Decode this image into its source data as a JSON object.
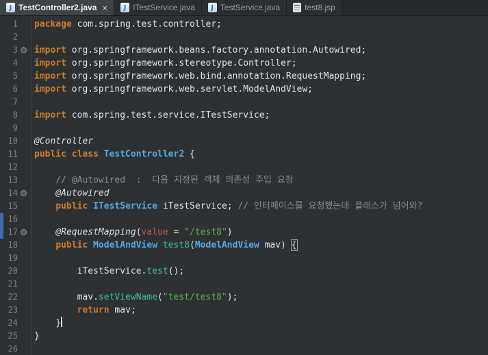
{
  "colors": {
    "editor_background": "#2E3134",
    "tab_bar_background": "#26292B",
    "active_tab_background": "#3E4346",
    "keyword": "#CE7B2C",
    "type": "#55A8E0",
    "string": "#55B345",
    "comment": "#858C91",
    "annotation": "#D9DEE1",
    "annotation_value": "#D14F4F",
    "method": "#3FBD9A",
    "plain_text": "#DFE2E4",
    "line_number": "#7C8287",
    "change_indicator": "#3E6CA8"
  },
  "tab_bar": {
    "tabs": [
      {
        "id": "testcontroller2",
        "label": "TestController2.java",
        "icon": "java-file-icon",
        "active": true,
        "close_label": "×"
      },
      {
        "id": "itestservice",
        "label": "ITestService.java",
        "icon": "java-file-icon",
        "active": false
      },
      {
        "id": "testservice",
        "label": "TestService.java",
        "icon": "java-file-icon",
        "active": false
      },
      {
        "id": "test8jsp",
        "label": "test8.jsp",
        "icon": "jsp-file-icon",
        "active": false
      }
    ]
  },
  "editor": {
    "lines": [
      {
        "num": "1",
        "segs": [
          {
            "c": "k",
            "t": "package"
          },
          {
            "c": "p",
            "t": " com.spring.test.controller;"
          }
        ]
      },
      {
        "num": "2",
        "segs": []
      },
      {
        "num": "3",
        "marker": true,
        "segs": [
          {
            "c": "k",
            "t": "import"
          },
          {
            "c": "p",
            "t": " org.springframework.beans.factory.annotation.Autowired;"
          }
        ]
      },
      {
        "num": "4",
        "segs": [
          {
            "c": "k",
            "t": "import"
          },
          {
            "c": "p",
            "t": " org.springframework.stereotype.Controller;"
          }
        ]
      },
      {
        "num": "5",
        "segs": [
          {
            "c": "k",
            "t": "import"
          },
          {
            "c": "p",
            "t": " org.springframework.web.bind.annotation.RequestMapping;"
          }
        ]
      },
      {
        "num": "6",
        "segs": [
          {
            "c": "k",
            "t": "import"
          },
          {
            "c": "p",
            "t": " org.springframework.web.servlet.ModelAndView;"
          }
        ]
      },
      {
        "num": "7",
        "segs": []
      },
      {
        "num": "8",
        "segs": [
          {
            "c": "k",
            "t": "import"
          },
          {
            "c": "p",
            "t": " com.spring.test.service.ITestService;"
          }
        ]
      },
      {
        "num": "9",
        "segs": []
      },
      {
        "num": "10",
        "segs": [
          {
            "c": "a",
            "t": "@Controller"
          }
        ]
      },
      {
        "num": "11",
        "segs": [
          {
            "c": "k",
            "t": "public class "
          },
          {
            "c": "t",
            "t": "TestController2"
          },
          {
            "c": "p",
            "t": " {"
          }
        ]
      },
      {
        "num": "12",
        "segs": []
      },
      {
        "num": "13",
        "segs": [
          {
            "c": "p",
            "t": "    "
          },
          {
            "c": "c",
            "t": "// @Autowired  :  다음 지정된 객체 의존성 주입 요청"
          }
        ]
      },
      {
        "num": "14",
        "marker": true,
        "segs": [
          {
            "c": "p",
            "t": "    "
          },
          {
            "c": "a",
            "t": "@Autowired"
          }
        ]
      },
      {
        "num": "15",
        "segs": [
          {
            "c": "p",
            "t": "    "
          },
          {
            "c": "k",
            "t": "public "
          },
          {
            "c": "t",
            "t": "ITestService"
          },
          {
            "c": "p",
            "t": " iTestService; "
          },
          {
            "c": "c",
            "t": "// 인터페이스를 요청했는데 클래스가 넘어와?"
          }
        ]
      },
      {
        "num": "16",
        "bar": true,
        "segs": []
      },
      {
        "num": "17",
        "bar": true,
        "marker": true,
        "segs": [
          {
            "c": "p",
            "t": "    "
          },
          {
            "c": "a",
            "t": "@RequestMapping"
          },
          {
            "c": "p",
            "t": "("
          },
          {
            "c": "v",
            "t": "value"
          },
          {
            "c": "p",
            "t": " = "
          },
          {
            "c": "s",
            "t": "\"/test8\""
          },
          {
            "c": "p",
            "t": ")"
          }
        ]
      },
      {
        "num": "18",
        "segs": [
          {
            "c": "p",
            "t": "    "
          },
          {
            "c": "k",
            "t": "public "
          },
          {
            "c": "t",
            "t": "ModelAndView"
          },
          {
            "c": "m",
            "t": " test8"
          },
          {
            "c": "p",
            "t": "("
          },
          {
            "c": "t",
            "t": "ModelAndView"
          },
          {
            "c": "p",
            "t": " mav) "
          },
          {
            "c": "b",
            "t": "{"
          }
        ]
      },
      {
        "num": "19",
        "segs": []
      },
      {
        "num": "20",
        "segs": [
          {
            "c": "p",
            "t": "        iTestService."
          },
          {
            "c": "m",
            "t": "test"
          },
          {
            "c": "p",
            "t": "();"
          }
        ]
      },
      {
        "num": "21",
        "segs": []
      },
      {
        "num": "22",
        "segs": [
          {
            "c": "p",
            "t": "        mav."
          },
          {
            "c": "m",
            "t": "setViewName"
          },
          {
            "c": "p",
            "t": "("
          },
          {
            "c": "s",
            "t": "\"test/test8\""
          },
          {
            "c": "p",
            "t": ");"
          }
        ]
      },
      {
        "num": "23",
        "segs": [
          {
            "c": "p",
            "t": "        "
          },
          {
            "c": "k",
            "t": "return"
          },
          {
            "c": "p",
            "t": " mav;"
          }
        ]
      },
      {
        "num": "24",
        "caret": true,
        "segs": [
          {
            "c": "p",
            "t": "    }"
          }
        ]
      },
      {
        "num": "25",
        "segs": [
          {
            "c": "p",
            "t": "}"
          }
        ]
      },
      {
        "num": "26",
        "segs": []
      }
    ]
  }
}
